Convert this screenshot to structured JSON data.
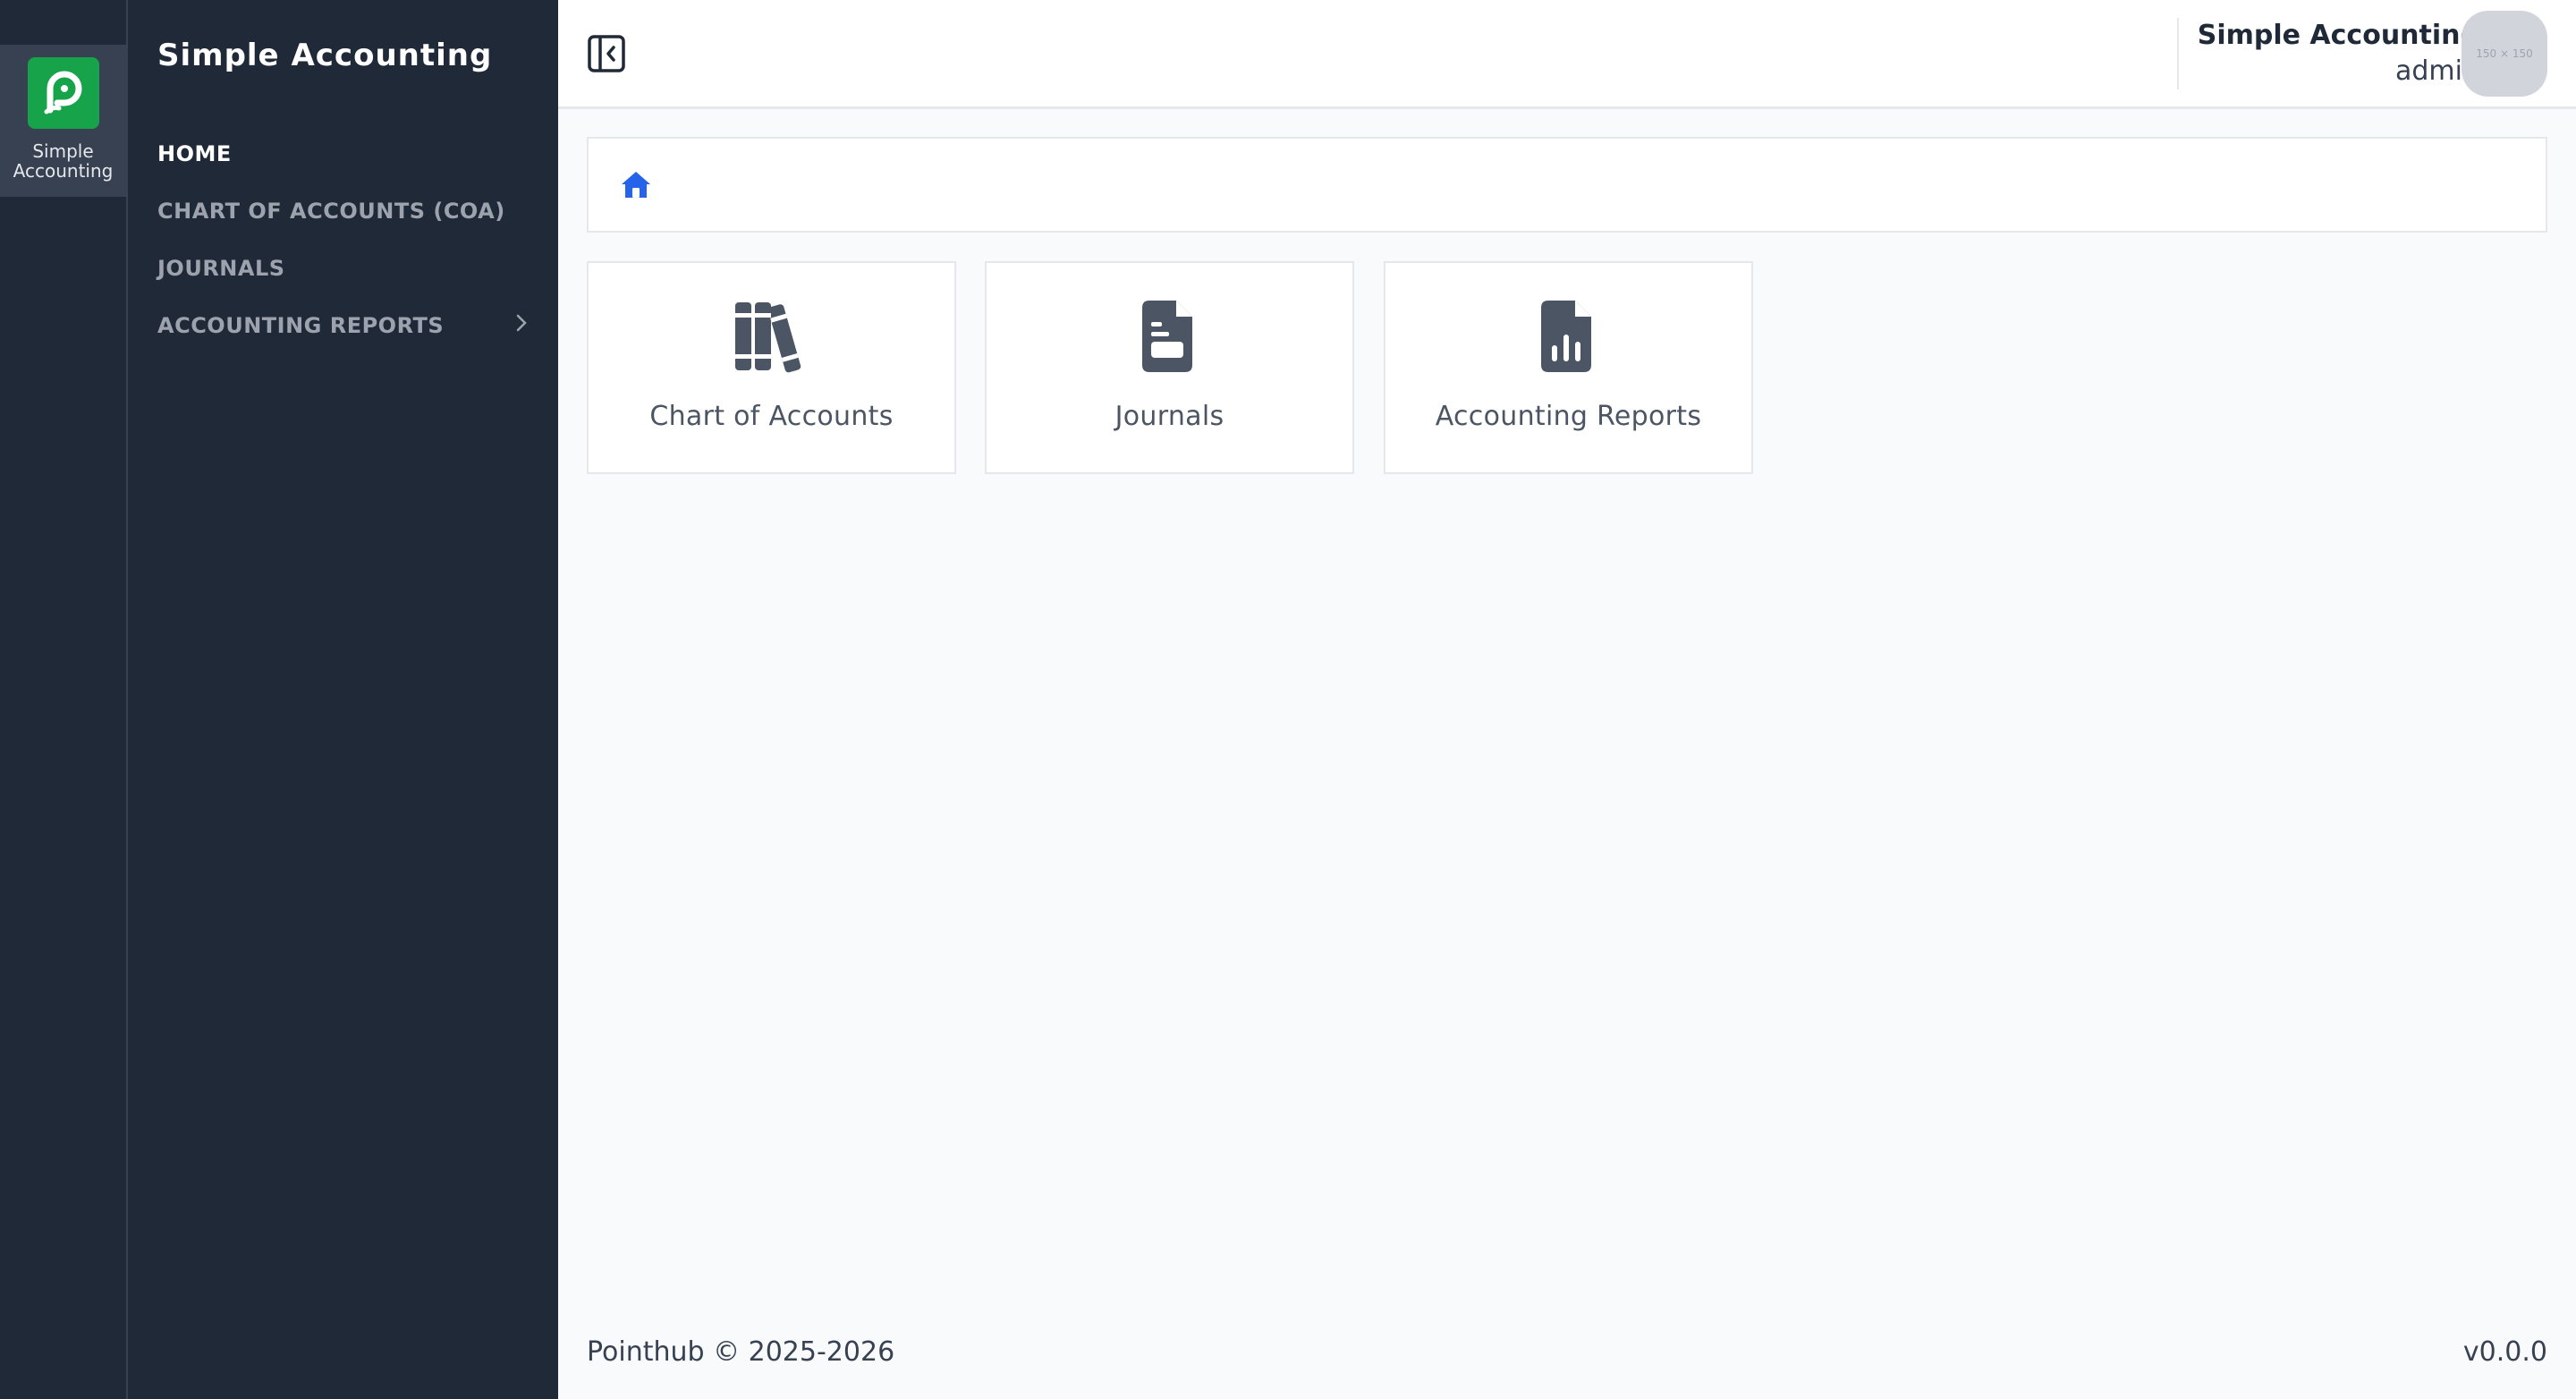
{
  "rail": {
    "app_label": "Simple\nAccounting",
    "logo_icon": "pointhub-logo-icon",
    "logo_color": "#16a34a"
  },
  "sidebar": {
    "title": "Simple Accounting",
    "items": [
      {
        "label": "HOME",
        "active": true
      },
      {
        "label": "CHART OF ACCOUNTS (COA)",
        "active": false
      },
      {
        "label": "JOURNALS",
        "active": false
      },
      {
        "label": "ACCOUNTING REPORTS",
        "active": false,
        "has_submenu": true
      }
    ]
  },
  "header": {
    "collapse_icon": "sidebar-collapse-icon",
    "user": {
      "app_name": "Simple Accounting",
      "username": "admin"
    },
    "avatar_placeholder": "150 × 150"
  },
  "breadcrumb": {
    "home_icon": "home-icon",
    "accent": "#2563eb"
  },
  "cards": [
    {
      "label": "Chart of Accounts",
      "icon": "books-icon"
    },
    {
      "label": "Journals",
      "icon": "file-lines-icon"
    },
    {
      "label": "Accounting Reports",
      "icon": "file-chart-icon"
    }
  ],
  "footer": {
    "copyright": "Pointhub © 2025-2026",
    "version": "v0.0.0"
  }
}
